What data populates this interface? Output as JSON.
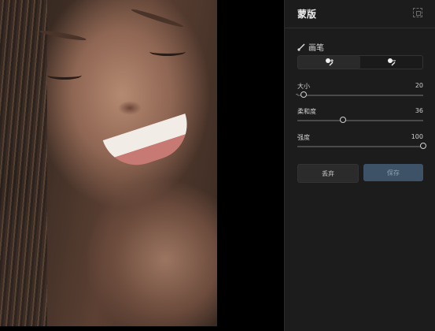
{
  "panel": {
    "title": "蒙版",
    "brush_label": "画笔",
    "modes": [
      "add",
      "subtract"
    ],
    "sliders": [
      {
        "label": "大小",
        "value": "20",
        "fraction": 0.05
      },
      {
        "label": "柔和度",
        "value": "36",
        "fraction": 0.36
      },
      {
        "label": "强度",
        "value": "100",
        "fraction": 1.0
      }
    ],
    "discard_label": "丢弃",
    "save_label": "保存"
  }
}
